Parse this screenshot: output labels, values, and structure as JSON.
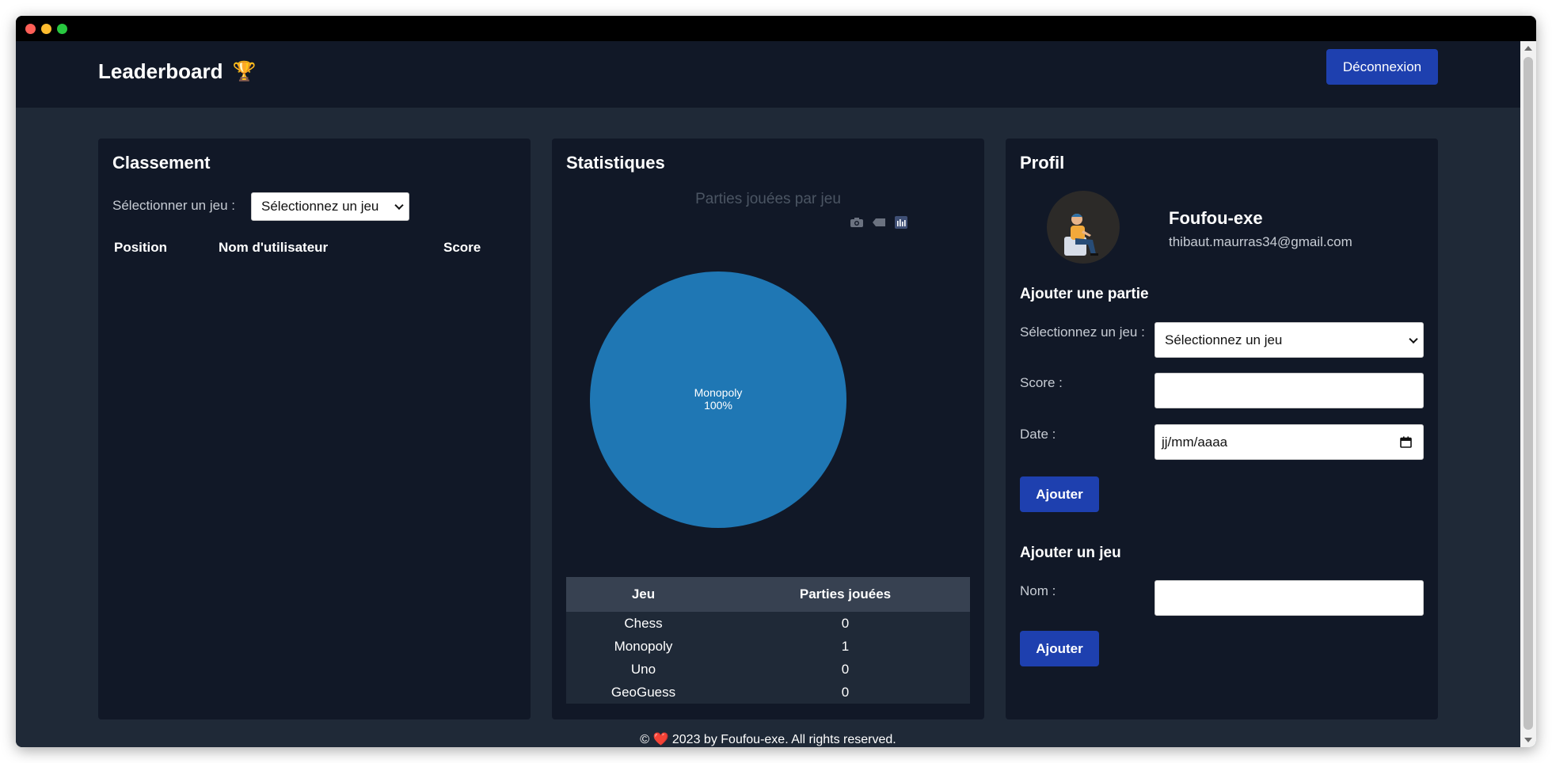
{
  "header": {
    "title": "Leaderboard",
    "trophy": "🏆",
    "logout_label": "Déconnexion"
  },
  "classement": {
    "title": "Classement",
    "select_label": "Sélectionner un jeu :",
    "select_value": "Sélectionnez un jeu",
    "columns": [
      "Position",
      "Nom d'utilisateur",
      "Score"
    ]
  },
  "statistiques": {
    "title": "Statistiques",
    "table_headers": [
      "Jeu",
      "Parties jouées"
    ],
    "rows": [
      {
        "game": "Chess",
        "played": "0"
      },
      {
        "game": "Monopoly",
        "played": "1"
      },
      {
        "game": "Uno",
        "played": "0"
      },
      {
        "game": "GeoGuess",
        "played": "0"
      }
    ]
  },
  "chart_data": {
    "type": "pie",
    "title": "Parties jouées par jeu",
    "labels": [
      "Monopoly"
    ],
    "values": [
      1
    ],
    "slice_texts": [
      "Monopoly",
      "100%"
    ],
    "colors": [
      "#1f77b4"
    ]
  },
  "profil": {
    "title": "Profil",
    "username": "Foufou-exe",
    "email": "thibaut.maurras34@gmail.com",
    "add_game_session": {
      "title": "Ajouter une partie",
      "game_label": "Sélectionnez un jeu :",
      "game_value": "Sélectionnez un jeu",
      "score_label": "Score :",
      "score_value": "",
      "date_label": "Date :",
      "date_placeholder": "jj/mm/aaaa",
      "button": "Ajouter"
    },
    "add_game": {
      "title": "Ajouter un jeu",
      "name_label": "Nom :",
      "name_value": "",
      "button": "Ajouter"
    }
  },
  "footer": {
    "text": "© ❤️ 2023 by Foufou-exe. All rights reserved."
  },
  "colors": {
    "header_bg": "#111827",
    "page_bg": "#1f2937",
    "card_bg": "#111827",
    "accent": "#1e40af",
    "pie": "#1f77b4"
  }
}
